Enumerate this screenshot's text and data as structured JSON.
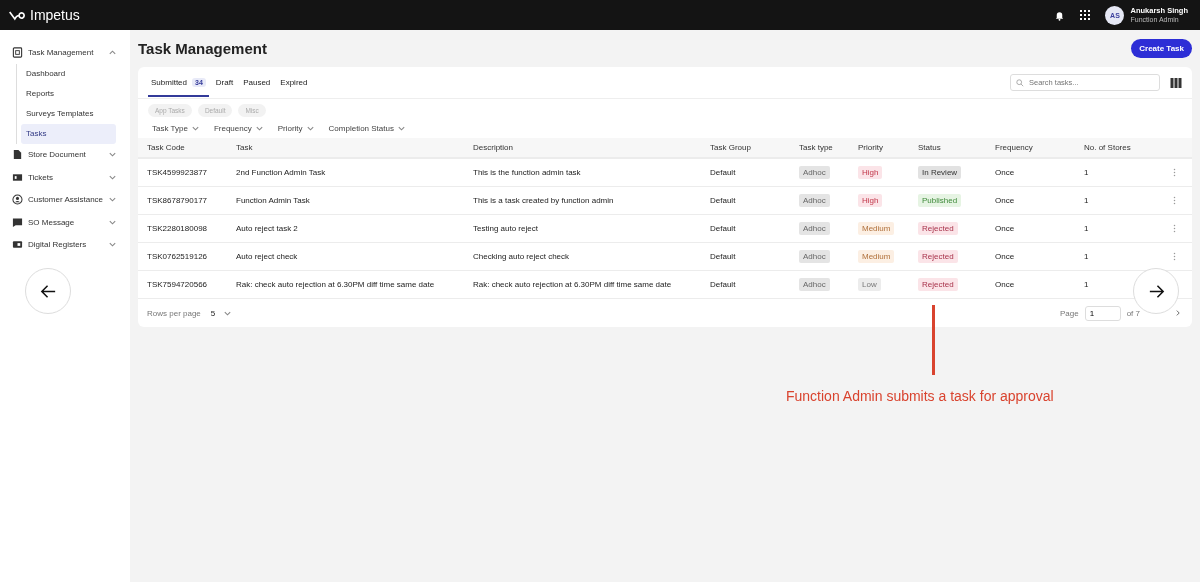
{
  "topbar": {
    "brand": "Impetus",
    "user": {
      "initials": "AS",
      "name": "Anukarsh Singh",
      "role": "Function Admin"
    }
  },
  "sidebar": {
    "items": [
      {
        "label": "Task Management",
        "expanded": true,
        "children": [
          {
            "label": "Dashboard",
            "selected": false
          },
          {
            "label": "Reports",
            "selected": false
          },
          {
            "label": "Surveys Templates",
            "selected": false
          },
          {
            "label": "Tasks",
            "selected": true
          }
        ]
      },
      {
        "label": "Store Document",
        "expanded": false
      },
      {
        "label": "Tickets",
        "expanded": false
      },
      {
        "label": "Customer Assistance",
        "expanded": false
      },
      {
        "label": "SO Message",
        "expanded": false
      },
      {
        "label": "Digital Registers",
        "expanded": false
      }
    ]
  },
  "page": {
    "title": "Task Management",
    "create_button": "Create Task"
  },
  "tabs": [
    {
      "label": "Submitted",
      "count": "34",
      "selected": true
    },
    {
      "label": "Draft",
      "selected": false
    },
    {
      "label": "Paused",
      "selected": false
    },
    {
      "label": "Expired",
      "selected": false
    }
  ],
  "search": {
    "placeholder": "Search tasks..."
  },
  "chips": [
    "App Tasks",
    "Default",
    "Misc"
  ],
  "filters": [
    "Task Type",
    "Frequency",
    "Priority",
    "Completion Status"
  ],
  "table": {
    "columns": [
      "Task Code",
      "Task",
      "Description",
      "Task Group",
      "Task type",
      "Priority",
      "Status",
      "Frequency",
      "No. of Stores"
    ],
    "rows": [
      {
        "code": "TSK4599923877",
        "task": "2nd Function Admin Task",
        "description": "This is the function admin task",
        "group": "Default",
        "type": "Adhoc",
        "priority": {
          "label": "High",
          "kind": "high"
        },
        "status": {
          "label": "In Review",
          "kind": "review"
        },
        "frequency": "Once",
        "stores": "1"
      },
      {
        "code": "TSK8678790177",
        "task": "Function Admin Task",
        "description": "This is a task created by function admin",
        "group": "Default",
        "type": "Adhoc",
        "priority": {
          "label": "High",
          "kind": "high"
        },
        "status": {
          "label": "Published",
          "kind": "published"
        },
        "frequency": "Once",
        "stores": "1"
      },
      {
        "code": "TSK2280180098",
        "task": "Auto reject task 2",
        "description": "Testing auto reject",
        "group": "Default",
        "type": "Adhoc",
        "priority": {
          "label": "Medium",
          "kind": "medium"
        },
        "status": {
          "label": "Rejected",
          "kind": "rejected"
        },
        "frequency": "Once",
        "stores": "1"
      },
      {
        "code": "TSK0762519126",
        "task": "Auto reject check",
        "description": "Checking auto reject check",
        "group": "Default",
        "type": "Adhoc",
        "priority": {
          "label": "Medium",
          "kind": "medium"
        },
        "status": {
          "label": "Rejected",
          "kind": "rejected"
        },
        "frequency": "Once",
        "stores": "1"
      },
      {
        "code": "TSK7594720566",
        "task": "Rak: check auto rejection at 6.30PM diff time same date",
        "description": "Rak: check auto rejection at 6.30PM diff time same date",
        "group": "Default",
        "type": "Adhoc",
        "priority": {
          "label": "Low",
          "kind": "low"
        },
        "status": {
          "label": "Rejected",
          "kind": "rejected"
        },
        "frequency": "Once",
        "stores": "1"
      }
    ]
  },
  "pagination": {
    "rows_label": "Rows per page",
    "rows_value": "5",
    "page_label": "Page",
    "page_value": "1",
    "of_label": "of 7"
  },
  "annotation": {
    "text": "Function Admin submits a task for approval"
  }
}
